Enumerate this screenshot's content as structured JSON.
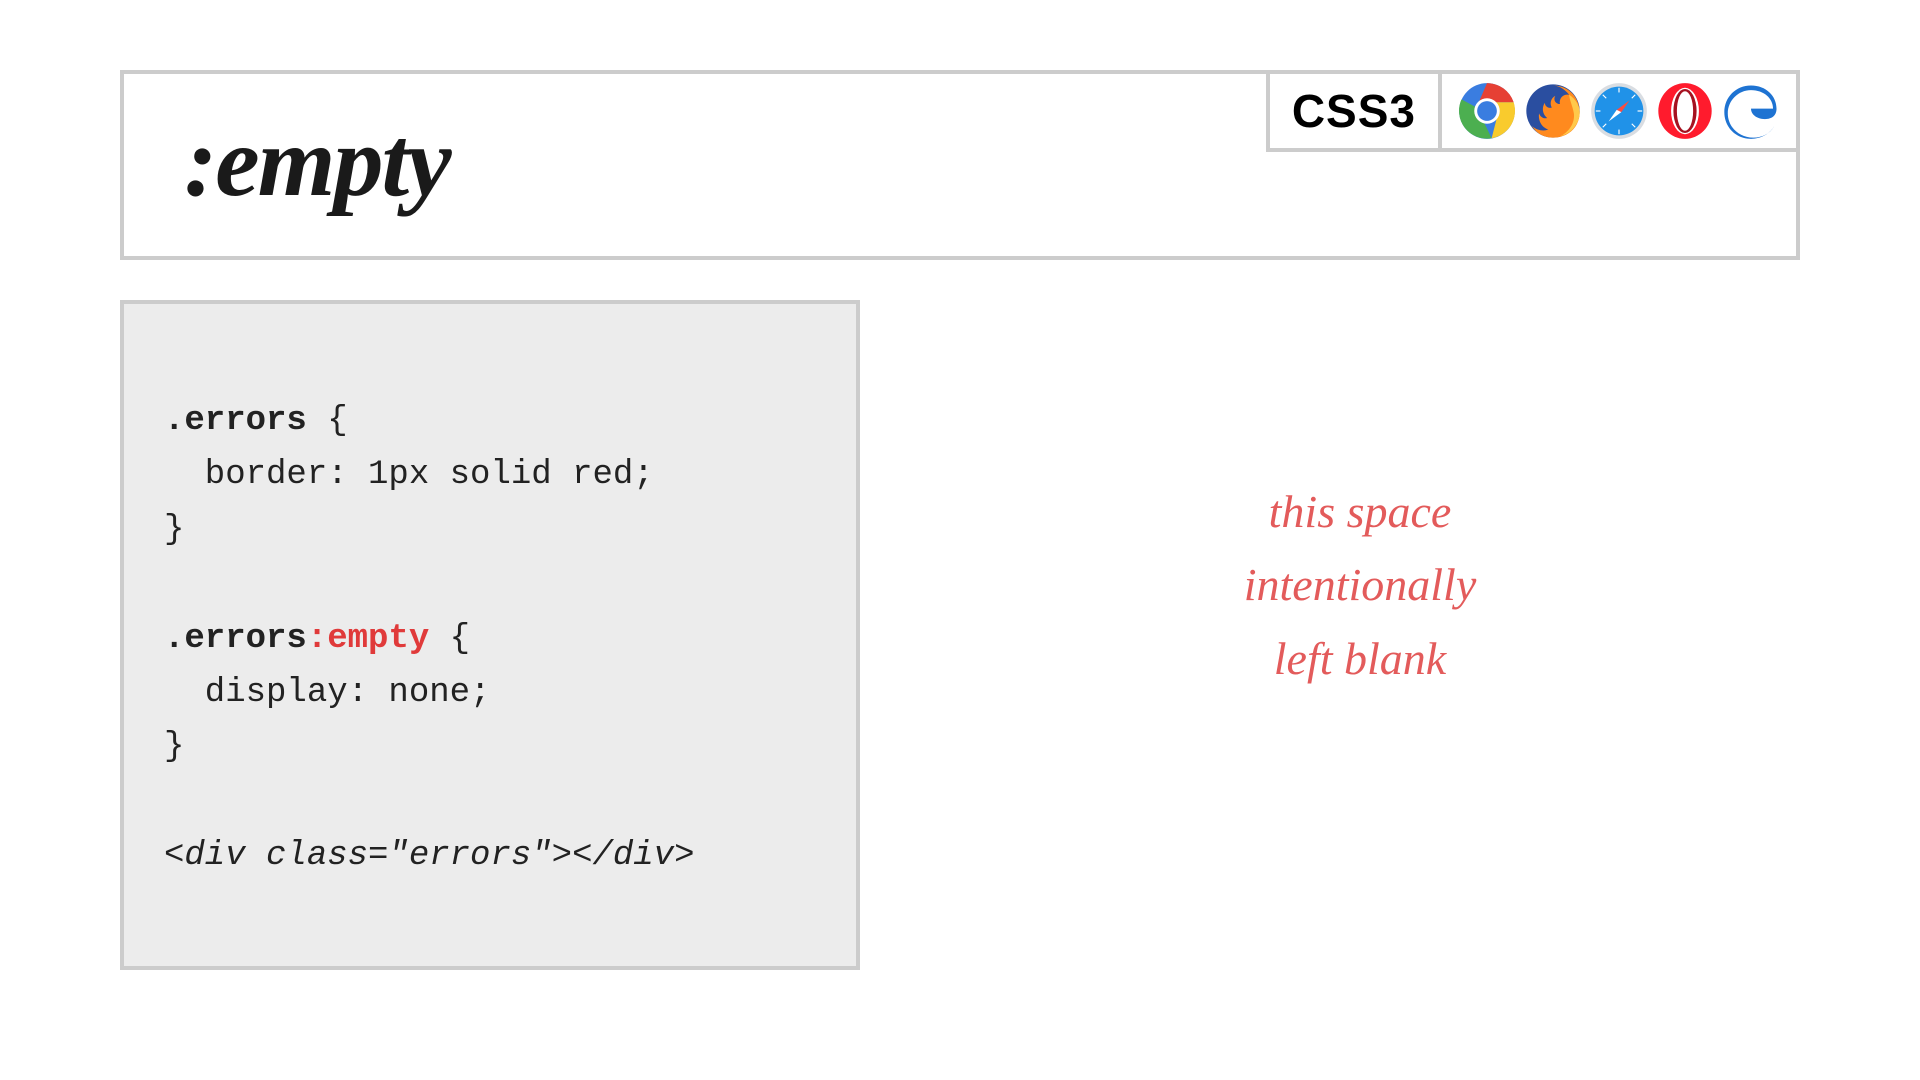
{
  "header": {
    "title": ":empty",
    "css_badge": "CSS3",
    "browsers": [
      "chrome",
      "firefox",
      "safari",
      "opera",
      "edge"
    ]
  },
  "code": {
    "rule1_selector": ".errors",
    "rule1_open": " {",
    "rule1_body": "  border: 1px solid red;",
    "rule1_close": "}",
    "rule2_selector": ".errors",
    "rule2_pseudo": ":empty",
    "rule2_open": " {",
    "rule2_body": "  display: none;",
    "rule2_close": "}",
    "html_sample": "<div class=\"errors\"></div>"
  },
  "right": {
    "note": "this space\nintentionally\nleft blank"
  }
}
